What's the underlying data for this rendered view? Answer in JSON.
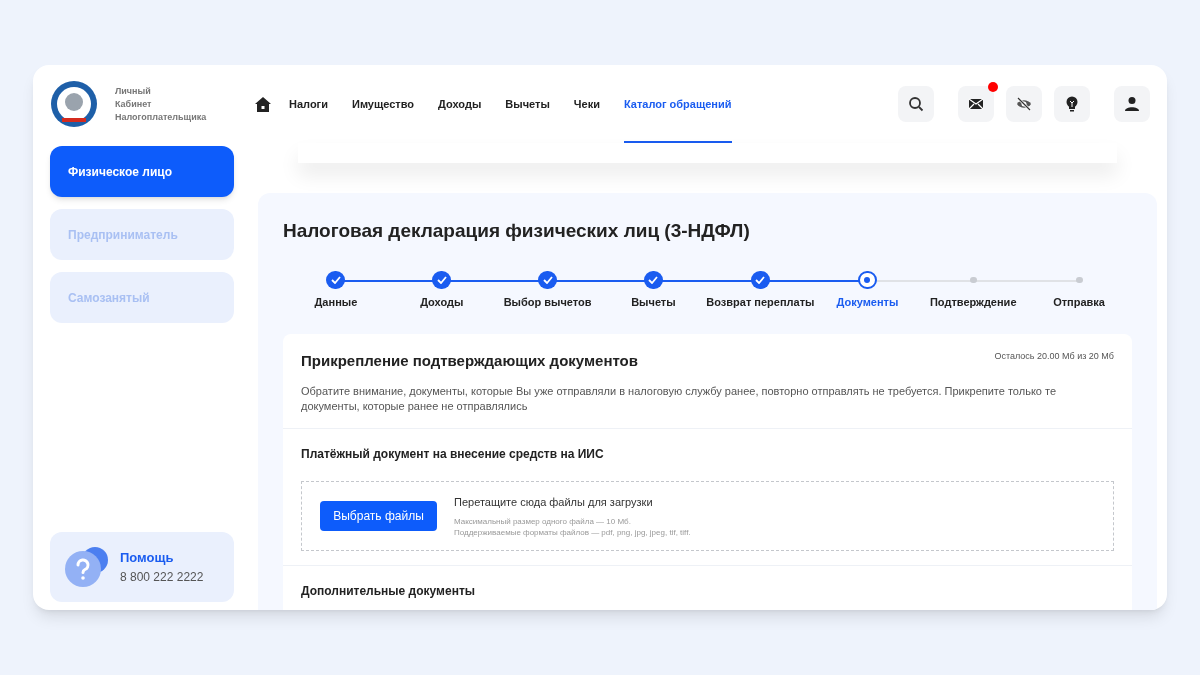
{
  "logo": {
    "lines": [
      "Личный",
      "Кабинет",
      "Налогоплательщика"
    ]
  },
  "nav": [
    {
      "label": "Налоги",
      "selected": false
    },
    {
      "label": "Имущество",
      "selected": false
    },
    {
      "label": "Доходы",
      "selected": false
    },
    {
      "label": "Вычеты",
      "selected": false
    },
    {
      "label": "Чеки",
      "selected": false
    },
    {
      "label": "Каталог обращений",
      "selected": true
    }
  ],
  "header_icons": [
    {
      "kind": "search",
      "badge": false
    },
    {
      "kind": "mail",
      "badge": true
    },
    {
      "kind": "eye-off",
      "badge": false
    },
    {
      "kind": "bulb",
      "badge": false
    },
    {
      "kind": "user",
      "badge": false
    }
  ],
  "sidebar": {
    "items": [
      {
        "label": "Физическое лицо",
        "selected": true
      },
      {
        "label": "Предприниматель",
        "selected": false
      },
      {
        "label": "Самозанятый",
        "selected": false
      }
    ],
    "help": {
      "title": "Помощь",
      "phone": "8 800 222 2222"
    }
  },
  "page_title": "Налоговая декларация физических лиц (3-НДФЛ)",
  "steps": [
    {
      "label": "Данные",
      "done": true,
      "selected": false
    },
    {
      "label": "Доходы",
      "done": true,
      "selected": false
    },
    {
      "label": "Выбор вычетов",
      "done": true,
      "selected": false
    },
    {
      "label": "Вычеты",
      "done": true,
      "selected": false
    },
    {
      "label": "Возврат переплаты",
      "done": true,
      "selected": false
    },
    {
      "label": "Документы",
      "done": false,
      "selected": true
    },
    {
      "label": "Подтверждение",
      "done": false,
      "selected": false
    },
    {
      "label": "Отправка",
      "done": false,
      "selected": false
    }
  ],
  "card": {
    "title": "Прикрепление подтверждающих документов",
    "quota": "Осталось 20.00 Мб из 20 Мб",
    "note": "Обратите внимание, документы, которые Вы уже отправляли в налоговую службу ранее, повторно отправлять не требуется. Прикрепите только те документы, которые ранее не отправлялись",
    "sections": [
      {
        "title": "Платёжный документ на внесение средств на ИИС",
        "button": "Выбрать файлы",
        "drop_title": "Перетащите сюда файлы для загрузки",
        "hints": [
          "Максимальный размер одного файла — 10 Мб.",
          "Поддерживаемые форматы файлов — pdf, png, jpg, jpeg, tif, tiff."
        ]
      },
      {
        "title": "Дополнительные документы"
      }
    ]
  }
}
